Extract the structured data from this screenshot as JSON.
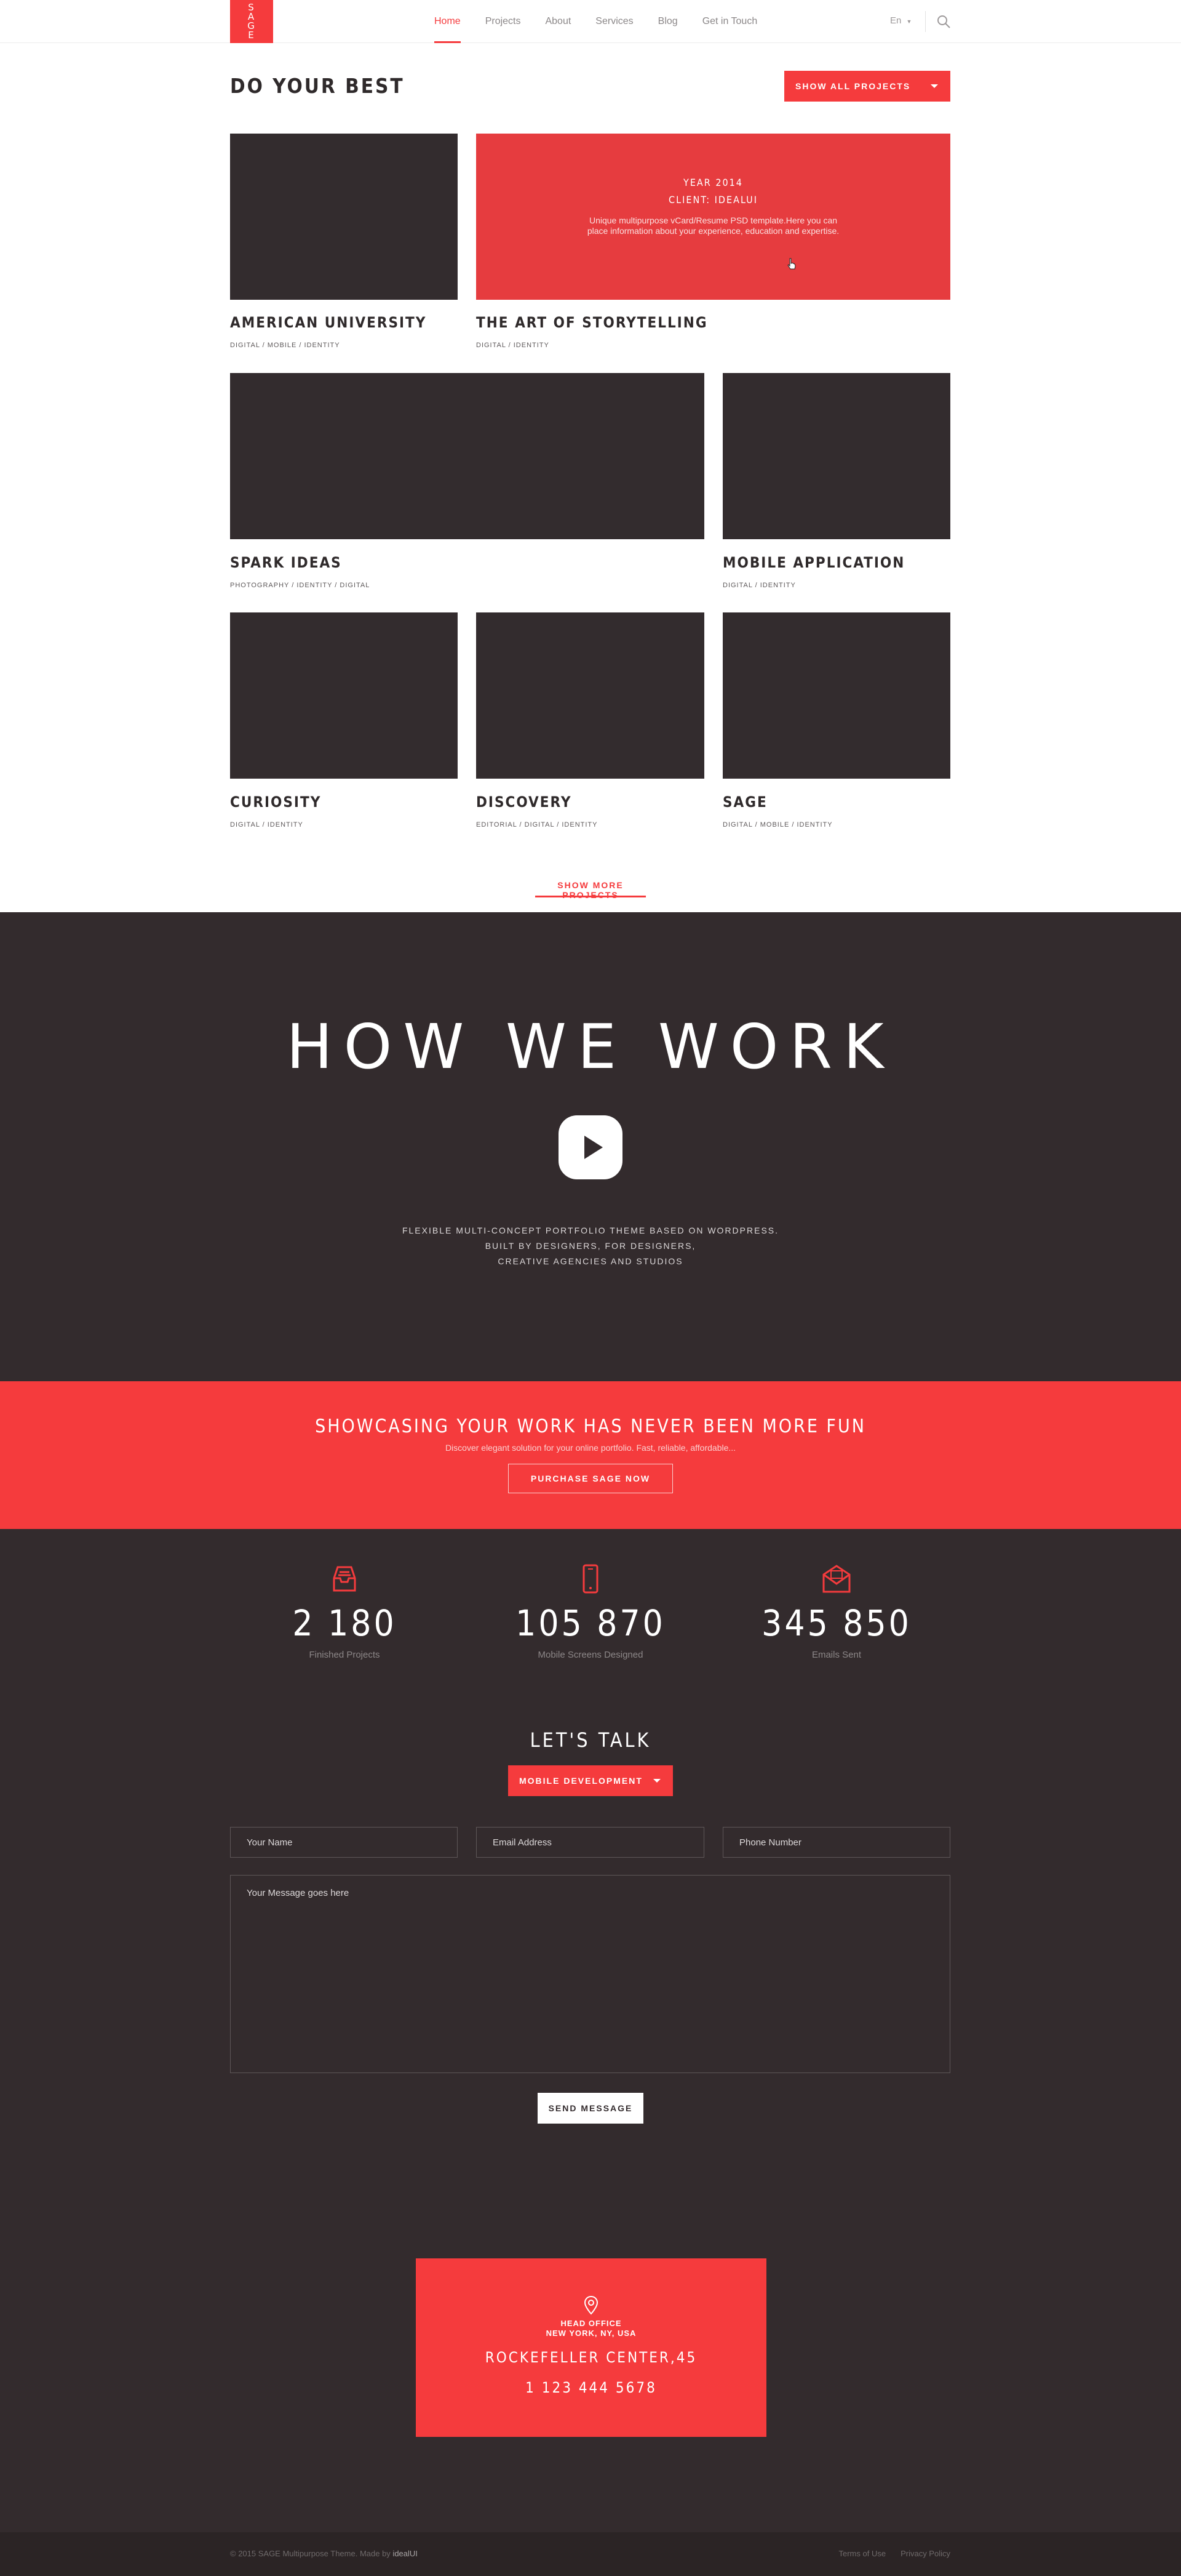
{
  "header": {
    "logo": [
      "S",
      "A",
      "G",
      "E"
    ],
    "nav": [
      "Home",
      "Projects",
      "About",
      "Services",
      "Blog",
      "Get in Touch"
    ],
    "lang": "En",
    "accent": "#f53b3d"
  },
  "projects": {
    "title": "DO YOUR BEST",
    "show_all": "SHOW ALL PROJECTS",
    "overlay": {
      "year": "YEAR 2014",
      "client": "CLIENT: IDEALUI",
      "desc": "Unique multipurpose vCard/Resume PSD template.Here you can place information about your experience, education and expertise."
    },
    "items": [
      {
        "title": "AMERICAN UNIVERSITY",
        "tags": "DIGITAL / MOBILE / IDENTITY"
      },
      {
        "title": "THE ART OF STORYTELLING",
        "tags": "DIGITAL / IDENTITY"
      },
      {
        "title": "SPARK IDEAS",
        "tags": "PHOTOGRAPHY / IDENTITY / DIGITAL"
      },
      {
        "title": "MOBILE APPLICATION",
        "tags": "DIGITAL / IDENTITY"
      },
      {
        "title": "CURIOSITY",
        "tags": "DIGITAL / IDENTITY"
      },
      {
        "title": "DISCOVERY",
        "tags": "EDITORIAL / DIGITAL / IDENTITY"
      },
      {
        "title": "SAGE",
        "tags": "DIGITAL / MOBILE / IDENTITY"
      }
    ],
    "show_more": "SHOW MORE PROJECTS"
  },
  "how": {
    "title": "HOW WE WORK",
    "line1": "FLEXIBLE MULTI-CONCEPT PORTFOLIO THEME  BASED ON WORDPRESS.",
    "line2": "BUILT BY DESIGNERS, FOR DESIGNERS,",
    "line3": "CREATIVE AGENCIES AND STUDIOS"
  },
  "banner": {
    "title": "SHOWCASING YOUR WORK HAS NEVER BEEN MORE FUN",
    "subtitle": "Discover elegant solution for your online portfolio. Fast, reliable, affordable...",
    "button": "PURCHASE SAGE NOW"
  },
  "stats": [
    {
      "icon": "inbox-icon",
      "value": "2 180",
      "label": "Finished Projects"
    },
    {
      "icon": "mobile-icon",
      "value": "105 870",
      "label": "Mobile Screens Designed"
    },
    {
      "icon": "envelope-icon",
      "value": "345 850",
      "label": "Emails Sent"
    }
  ],
  "contact": {
    "title": "LET'S TALK",
    "select": "MOBILE DEVELOPMENT",
    "name_ph": "Your Name",
    "email_ph": "Email Address",
    "phone_ph": "Phone Number",
    "message_ph": "Your Message goes here",
    "send": "SEND MESSAGE"
  },
  "office": {
    "line1": "HEAD OFFICE",
    "line2": "NEW YORK, NY, USA",
    "address": "ROCKEFELLER CENTER,45",
    "phone": "1 123 444 5678"
  },
  "footer": {
    "copy_prefix": "© 2015 SAGE Multipurpose Theme. Made by",
    "copy_author": "idealUI",
    "terms": "Terms of Use",
    "privacy": "Privacy Policy"
  }
}
